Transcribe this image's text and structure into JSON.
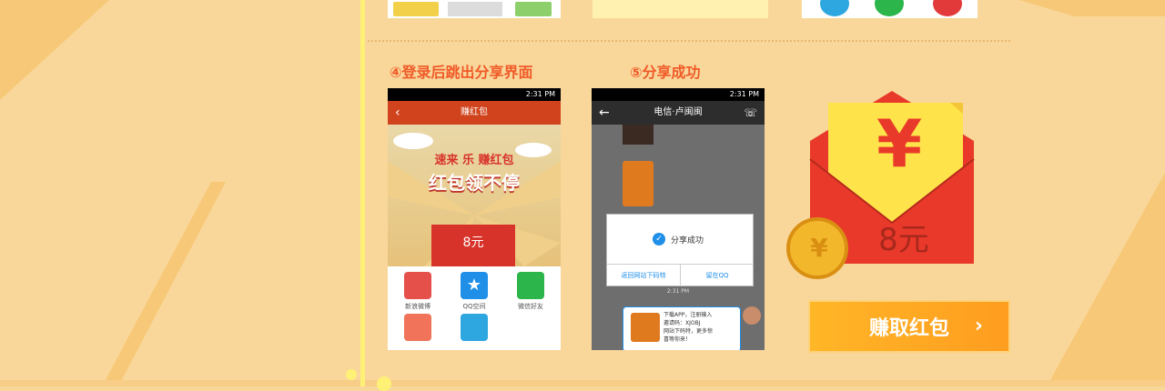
{
  "steps": {
    "step4_title": "④登录后跳出分享界面",
    "step5_title": "⑤分享成功"
  },
  "phone1": {
    "status_time": "2:31 PM",
    "appbar_title": "赚红包",
    "banner_line1": "速来 乐 赚红包",
    "banner_line2": "红包领不停",
    "envelope_amount": "8元",
    "share_items": [
      {
        "label": "新浪微博"
      },
      {
        "label": "QQ空间"
      },
      {
        "label": "微信好友"
      },
      {
        "label": ""
      },
      {
        "label": ""
      }
    ]
  },
  "phone2": {
    "status_time": "2:31 PM",
    "appbar_title": "电信·卢闽闽",
    "dialog_message": "分享成功",
    "dialog_back": "返回网站下码特",
    "dialog_stay": "留在QQ",
    "msg_time": "2:31 PM",
    "card_line1": "下载APP，注册输入",
    "card_line2": "邀请码：XJOBJ",
    "card_line3": "网站下码特，更多惊",
    "card_line4": "喜等你来！"
  },
  "hongbao": {
    "symbol": "¥",
    "amount": "8元",
    "coin_symbol": "¥"
  },
  "cta": {
    "label": "赚取红包",
    "arrow": "›"
  },
  "colors": {
    "background": "#f9d79a",
    "accent_orange": "#f05a28",
    "envelope_red": "#e8392a",
    "button_orange": "#ffa522"
  }
}
